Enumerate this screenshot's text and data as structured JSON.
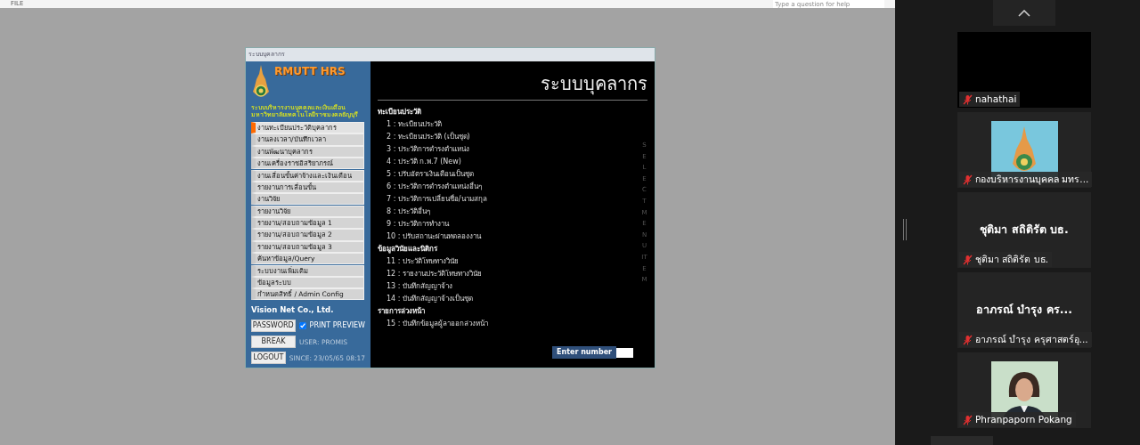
{
  "shared_screen": {
    "menu_label": "FILE",
    "help_placeholder": "Type a question for help",
    "app_window": {
      "title": "ระบบบุคลากร",
      "logo_title": "RMUTT HRS",
      "logo_subtitle": [
        "ระบบบริหารงานบุคคลและเงินเดือน",
        "มหาวิทยาลัยเทคโนโลยีราชมงคลธัญบุรี"
      ],
      "nav_items": [
        {
          "label": "งานทะเบียนประวัติบุคลากร",
          "selected": true
        },
        {
          "label": "งานลงเวลา/บันทึกเวลา",
          "selected": false
        },
        {
          "label": "งานพัฒนาบุคลากร",
          "selected": false
        },
        {
          "label": "งานเครื่องราชอิสริยาภรณ์",
          "selected": false
        },
        {
          "label": "งานเลื่อนขั้นค่าจ้างและเงินเดือน",
          "selected": false
        },
        {
          "label": "รายงานการเลื่อนขั้น",
          "selected": false
        },
        {
          "label": "งานวิจัย",
          "selected": false
        },
        {
          "label": "รายงานวิจัย",
          "selected": false
        },
        {
          "label": "รายงาน/สอบถามข้อมูล 1",
          "selected": false
        },
        {
          "label": "รายงาน/สอบถามข้อมูล 2",
          "selected": false
        },
        {
          "label": "รายงาน/สอบถามข้อมูล 3",
          "selected": false
        },
        {
          "label": "ค้นหาข้อมูล/Query",
          "selected": false
        },
        {
          "label": "ระบบงานเพิ่มเติม",
          "selected": false
        },
        {
          "label": "ข้อมูลระบบ",
          "selected": false
        },
        {
          "label": "กำหนดสิทธิ์ / Admin Config",
          "selected": false
        }
      ],
      "company": "Vision Net Co., Ltd.",
      "buttons": [
        "PASSWORD",
        "BREAK",
        "LOGOUT"
      ],
      "print_preview": {
        "label": "PRINT PREVIEW",
        "checked": true
      },
      "user": "USER: PROMIS",
      "since": "SINCE: 23/05/65 08:17",
      "heading": "ระบบบุคลากร",
      "sections": [
        {
          "title": "ทะเบียนประวัติ",
          "items": [
            "1 : ทะเบียนประวัติ",
            "2 : ทะเบียนประวัติ (เป็นชุด)",
            "3 : ประวัติการดำรงตำแหน่ง",
            "4 : ประวัติ ก.พ.7 (New)",
            "5 : ปรับอัตราเงินเดือนเป็นชุด",
            "6 : ประวัติการดำรงตำแหน่งอื่นๆ",
            "7 : ประวัติการเปลี่ยนชื่อ/นามสกุล",
            "8 : ประวัติอื่นๆ",
            "9 : ประวัติการทำงาน",
            "10 : ปรับสถานะผ่านทดลองงาน"
          ]
        },
        {
          "title": "ข้อมูลวินัยและนิติกร",
          "items": [
            "11 : ประวัติโทษทางวินัย",
            "12 : รายงานประวัติโทษทางวินัย",
            "13 : บันทึกสัญญาจ้าง",
            "14 : บันทึกสัญญาจ้างเป็นชุด"
          ]
        },
        {
          "title": "รายการล่วงหน้า",
          "items": [
            "15 : บันทึกข้อมูลผู้ลาออกล่วงหน้า"
          ]
        }
      ],
      "side_caption": "SELECT MENU ITEM",
      "enter_number_label": "Enter number"
    }
  },
  "participants": [
    {
      "kind": "video_off",
      "name": "nahathai",
      "muted": true
    },
    {
      "kind": "picture",
      "name": "กองบริหารงานบุคคล มทร...",
      "muted": true
    },
    {
      "kind": "name",
      "display_name": "ชุติมา สถิติรัต บธ.",
      "name": "ชุติมา สถิติรัต บธ.",
      "muted": true
    },
    {
      "kind": "name",
      "display_name": "อาภรณ์ บำรุง คร...",
      "name": "อาภรณ์ บำรุง ครุศาสตร์อุ...",
      "muted": true
    },
    {
      "kind": "picture",
      "name": "Phranpaporn Pokang",
      "muted": true
    }
  ]
}
